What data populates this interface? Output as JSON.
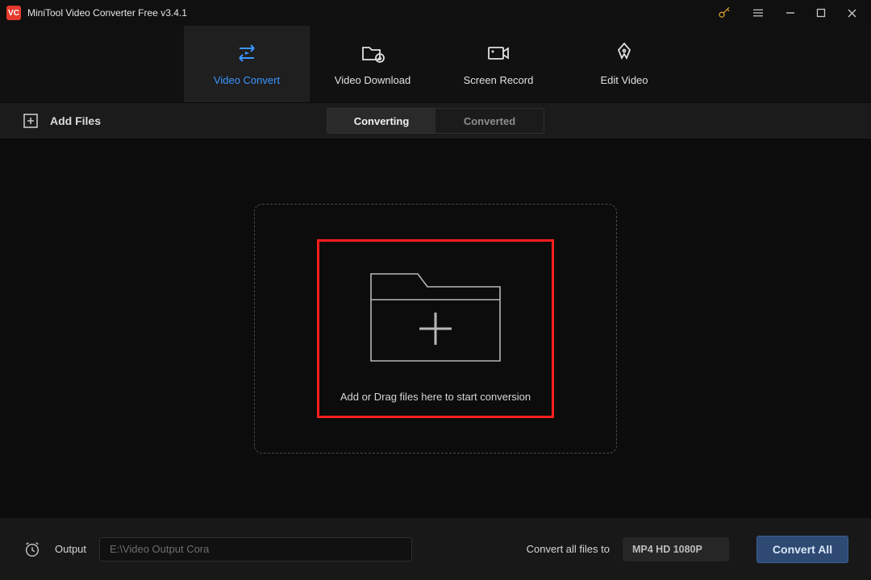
{
  "titlebar": {
    "app_title": "MiniTool Video Converter Free v3.4.1",
    "app_icon_text": "VC"
  },
  "mainnav": {
    "tabs": [
      {
        "label": "Video Convert",
        "active": true
      },
      {
        "label": "Video Download",
        "active": false
      },
      {
        "label": "Screen Record",
        "active": false
      },
      {
        "label": "Edit Video",
        "active": false
      }
    ]
  },
  "toolbar": {
    "add_files_label": "Add Files",
    "subtabs": [
      {
        "label": "Converting",
        "active": true
      },
      {
        "label": "Converted",
        "active": false
      }
    ]
  },
  "dropzone": {
    "hint": "Add or Drag files here to start conversion"
  },
  "bottombar": {
    "output_label": "Output",
    "output_path": "E:\\Video Output Cora",
    "convert_all_label": "Convert all files to",
    "format_value": "MP4 HD 1080P",
    "convert_all_button": "Convert All"
  }
}
